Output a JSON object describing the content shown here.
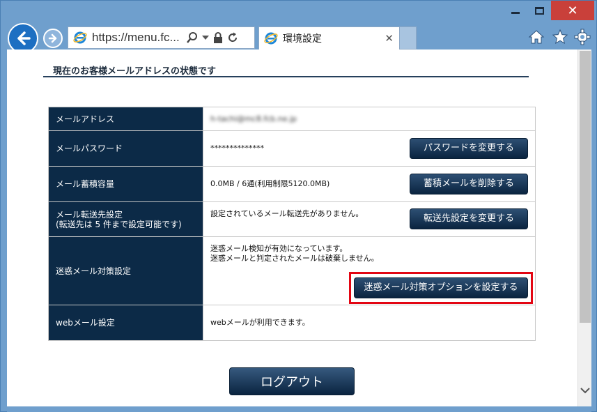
{
  "window": {
    "close_glyph": "✕"
  },
  "nav": {
    "address": "https://menu.fc...",
    "tab_title": "環境設定",
    "tab_close": "✕"
  },
  "page": {
    "section_title": "現在のお客様メールアドレスの状態です",
    "rows": [
      {
        "label": "メールアドレス",
        "value": "h-tachi@mc8.fcb.ne.jp"
      },
      {
        "label": "メールパスワード",
        "value": "**************",
        "button": "パスワードを変更する"
      },
      {
        "label": "メール蓄積容量",
        "value": "0.0MB / 6通(利用制限5120.0MB)",
        "button": "蓄積メールを削除する"
      },
      {
        "label_line1": "メール転送先設定",
        "label_line2": "(転送先は 5 件まで設定可能です)",
        "value": "設定されているメール転送先がありません。",
        "button": "転送先設定を変更する"
      },
      {
        "label": "迷惑メール対策設定",
        "value_line1": "迷惑メール検知が有効になっています。",
        "value_line2": "迷惑メールと判定されたメールは破棄しません。",
        "button": "迷惑メール対策オプションを設定する"
      },
      {
        "label": "webメール設定",
        "value": "webメールが利用できます。"
      }
    ],
    "logout_button": "ログアウト"
  },
  "colors": {
    "header_cell": "#0c2a47",
    "highlight": "#e30613",
    "chrome": "#6f9fcd"
  }
}
